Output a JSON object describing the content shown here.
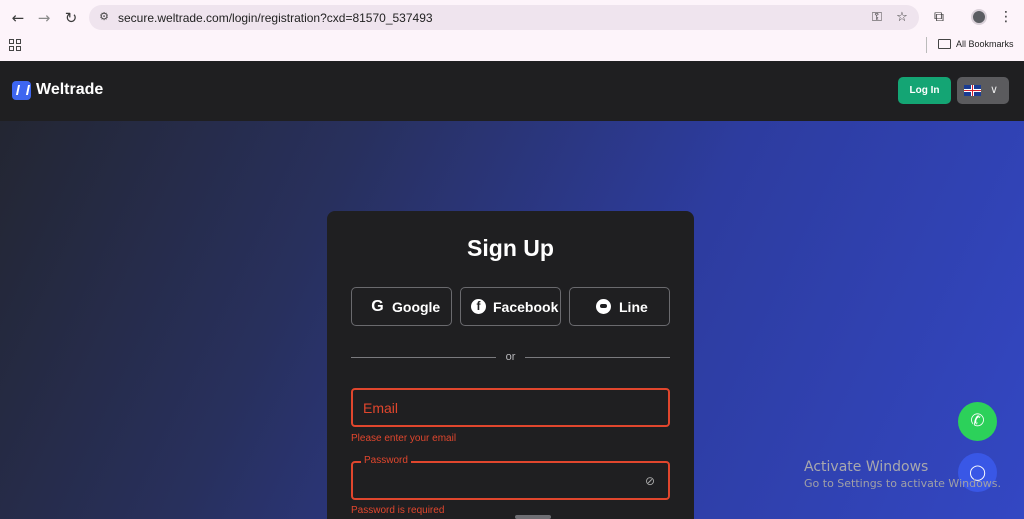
{
  "browser": {
    "back_icon": "←",
    "forward_icon": "→",
    "reload_icon": "↻",
    "site_info_icon": "⚙",
    "url": "secure.weltrade.com/login/registration?cxd=81570_537493",
    "password_key_icon": "⚿",
    "bookmark_star_icon": "☆",
    "extensions_icon": "⧉",
    "menu_icon": "⋮",
    "bookmarks_label": "All Bookmarks"
  },
  "header": {
    "brand": "Weltrade",
    "login_label": "Log In",
    "language_chevron": "∨"
  },
  "signup": {
    "title": "Sign Up",
    "social": [
      {
        "label": "Google",
        "glyph": "G"
      },
      {
        "label": "Facebook",
        "glyph": "f"
      },
      {
        "label": "Line",
        "glyph": ""
      }
    ],
    "or_label": "or",
    "email_placeholder": "Email",
    "email_error": "Please enter your email",
    "password_label": "Password",
    "password_error": "Password is required",
    "eye_off_icon": "⊘"
  },
  "floating": {
    "whatsapp_icon": "✆",
    "chat_icon": "◯"
  },
  "watermark": {
    "title": "Activate Windows",
    "subtitle": "Go to Settings to activate Windows."
  },
  "colors": {
    "accent_green": "#14a574",
    "error_red": "#e0462d",
    "brand_blue": "#3e66f0",
    "whatsapp_green": "#2cd15a"
  }
}
